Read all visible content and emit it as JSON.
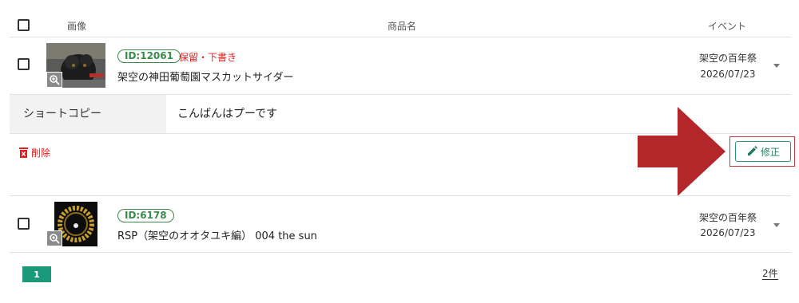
{
  "header": {
    "col_image": "画像",
    "col_name": "商品名",
    "col_event": "イベント"
  },
  "rows": [
    {
      "id_badge": "ID:12061",
      "status": "保留・下書き",
      "name": "架空の神田葡萄園マスカットサイダー",
      "event": "架空の百年祭",
      "date": "2026/07/23"
    },
    {
      "id_badge": "ID:6178",
      "status": "",
      "name": "RSP（架空のオオタユキ編） 004 the sun",
      "event": "架空の百年祭",
      "date": "2026/07/23"
    }
  ],
  "short_copy": {
    "label": "ショートコピー",
    "value": "こんばんはプーです"
  },
  "actions": {
    "delete_label": "削除",
    "edit_label": "修正"
  },
  "pagination": {
    "current_page": "1",
    "total": "2件"
  },
  "colors": {
    "accent": "#1a9a7a",
    "danger": "#e02020",
    "annotation_arrow": "#b3262a"
  }
}
